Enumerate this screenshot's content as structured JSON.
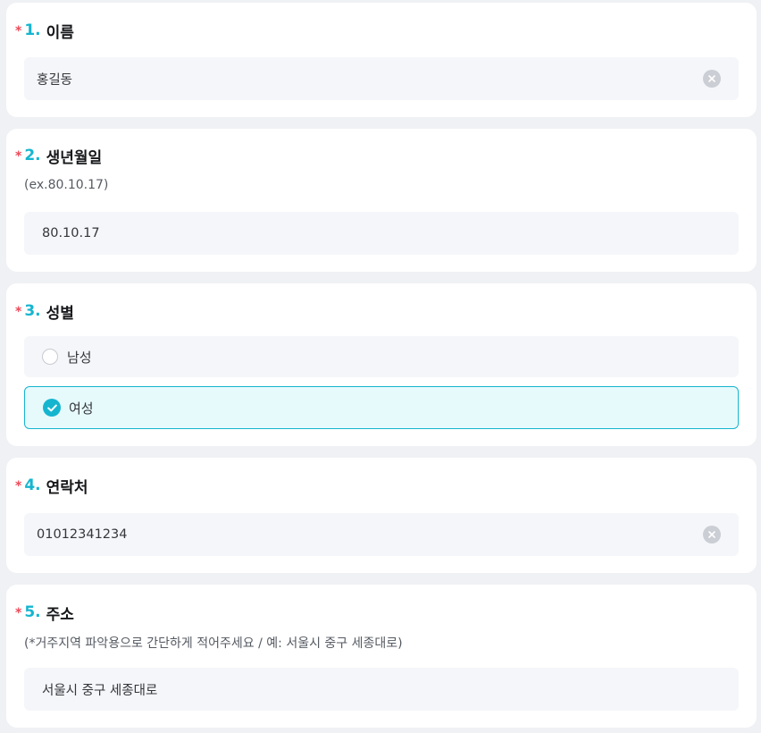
{
  "required_mark": "*",
  "questions": {
    "q1": {
      "number": "1.",
      "label": "이름",
      "value": "홍길동"
    },
    "q2": {
      "number": "2.",
      "label": "생년월일",
      "hint": "(ex.80.10.17)",
      "value": "80.10.17"
    },
    "q3": {
      "number": "3.",
      "label": "성별",
      "options": [
        {
          "label": "남성",
          "selected": false
        },
        {
          "label": "여성",
          "selected": true
        }
      ]
    },
    "q4": {
      "number": "4.",
      "label": "연락처",
      "value": "01012341234"
    },
    "q5": {
      "number": "5.",
      "label": "주소",
      "hint": "(*거주지역 파악용으로 간단하게 적어주세요 / 예: 서울시 중구 세종대로)",
      "value": "서울시 중구 세종대로"
    }
  },
  "icons": {
    "clear": "clear-icon",
    "check": "check-icon"
  },
  "colors": {
    "accent": "#16b5cf",
    "required": "#ef4a5a",
    "field_bg": "#f5f6f9",
    "selected_bg": "#e6fafc"
  }
}
